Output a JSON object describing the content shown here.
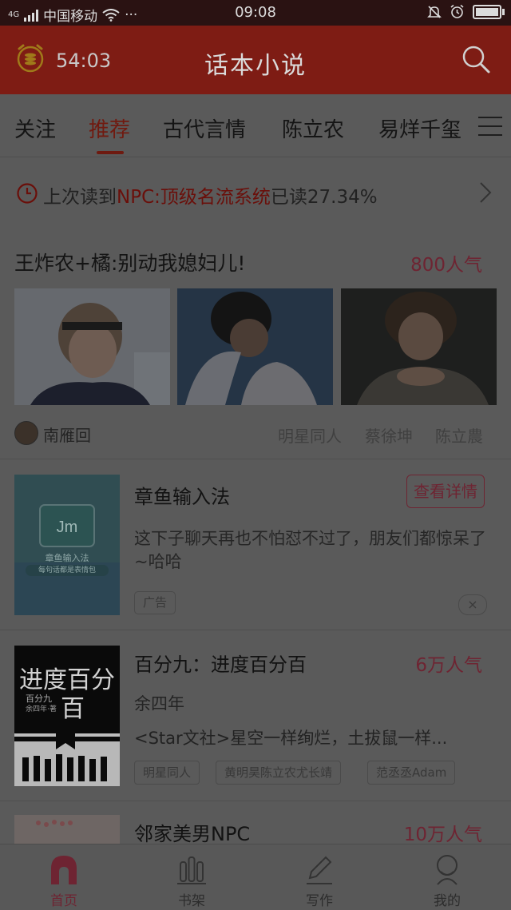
{
  "status_bar": {
    "network": "4G",
    "carrier": "中国移动",
    "more": "···",
    "time": "09:08"
  },
  "header": {
    "timer": "54:03",
    "title": "话本小说"
  },
  "tabs": [
    {
      "label": "关注"
    },
    {
      "label": "推荐",
      "active": true
    },
    {
      "label": "古代言情"
    },
    {
      "label": "陈立农"
    },
    {
      "label": "易烊千玺"
    }
  ],
  "last_read": {
    "prefix": "上次读到",
    "book": "NPC:顶级名流系统",
    "suffix": "已读27.34%"
  },
  "featured": {
    "title": "王炸农+橘:别动我媳妇儿!",
    "popularity": "800人气",
    "author": "南雁回",
    "tags": [
      "明星同人",
      "蔡徐坤",
      "陈立農"
    ]
  },
  "ad": {
    "title": "章鱼输入法",
    "button": "查看详情",
    "description": "这下子聊天再也不怕怼不过了，朋友们都惊呆了~哈哈",
    "tag": "广告",
    "close": "×",
    "cover": {
      "app_name": "章鱼输入法",
      "slogan": "每句话都是表情包"
    }
  },
  "books": [
    {
      "title": "百分九：进度百分百",
      "popularity": "6万人气",
      "author": "余四年",
      "description": "<Star文社>星空一样绚烂，土拔鼠一样...",
      "tags": [
        "明星同人",
        "黄明昊陈立农尤长靖",
        "范丞丞Adam"
      ],
      "cover": {
        "line1": "进度百分",
        "line2": "百",
        "small1": "百分九",
        "small2": "余四年·著"
      }
    },
    {
      "title": "邻家美男NPC",
      "popularity": "10万人气"
    }
  ],
  "bottom_nav": [
    {
      "label": "首页",
      "active": true
    },
    {
      "label": "书架"
    },
    {
      "label": "写作"
    },
    {
      "label": "我的"
    }
  ]
}
